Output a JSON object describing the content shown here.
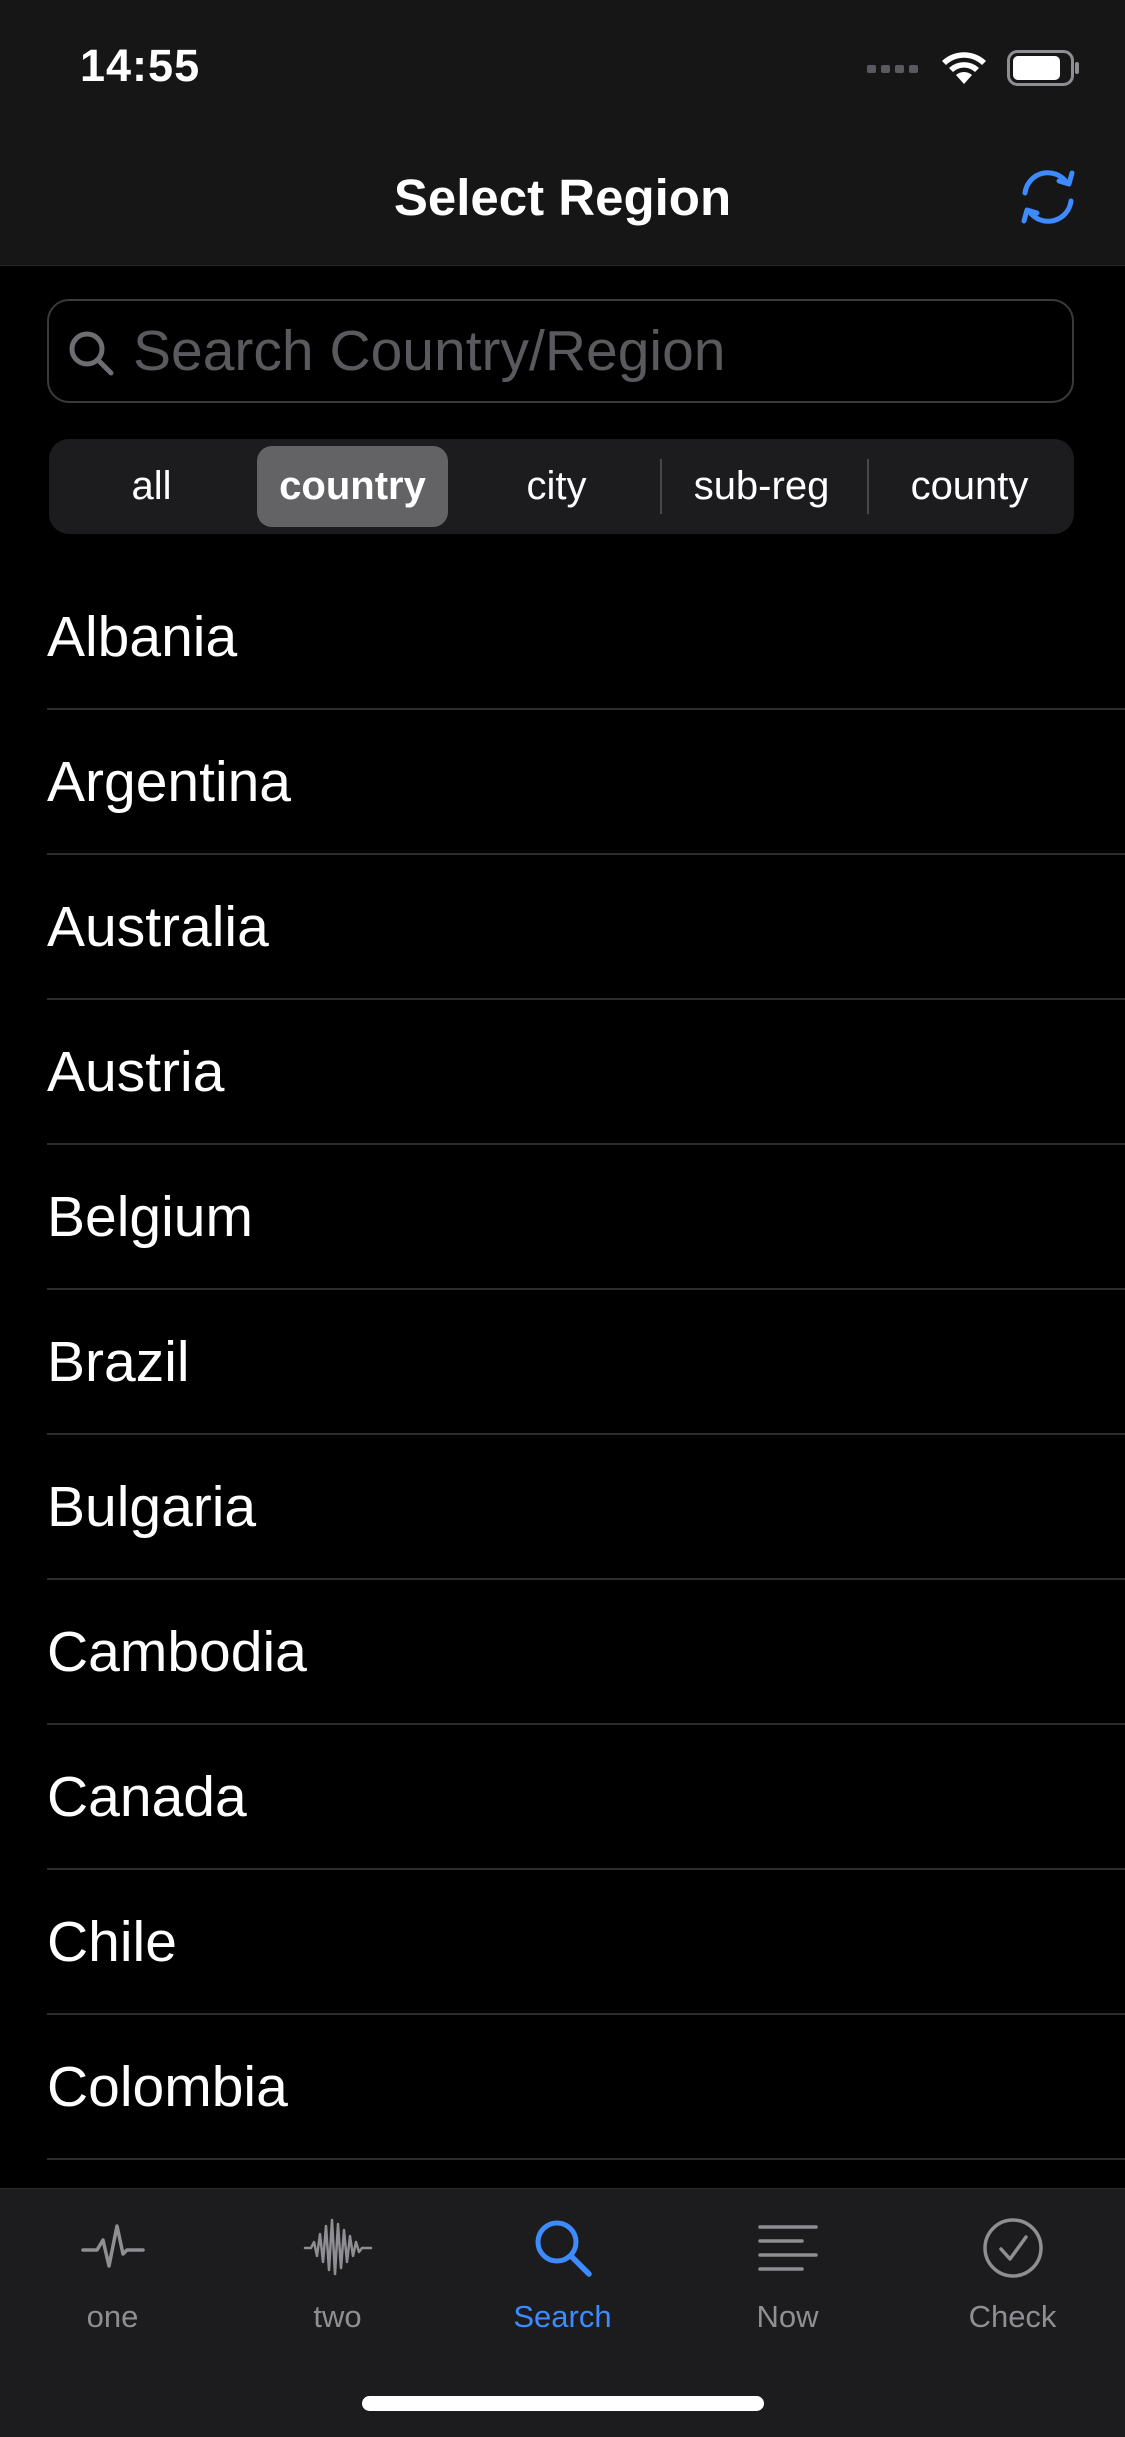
{
  "status_bar": {
    "time": "14:55"
  },
  "nav": {
    "title": "Select Region",
    "refresh_icon": "refresh-icon"
  },
  "search": {
    "placeholder": "Search Country/Region",
    "value": ""
  },
  "segments": [
    {
      "label": "all",
      "selected": false
    },
    {
      "label": "country",
      "selected": true
    },
    {
      "label": "city",
      "selected": false
    },
    {
      "label": "sub-reg",
      "selected": false
    },
    {
      "label": "county",
      "selected": false
    }
  ],
  "regions": [
    "Albania",
    "Argentina",
    "Australia",
    "Austria",
    "Belgium",
    "Brazil",
    "Bulgaria",
    "Cambodia",
    "Canada",
    "Chile",
    "Colombia"
  ],
  "tabs": [
    {
      "label": "one",
      "icon": "heartbeat-icon",
      "active": false
    },
    {
      "label": "two",
      "icon": "waveform-icon",
      "active": false
    },
    {
      "label": "Search",
      "icon": "search-icon",
      "active": true
    },
    {
      "label": "Now",
      "icon": "lines-icon",
      "active": false
    },
    {
      "label": "Check",
      "icon": "checkmark-circle-icon",
      "active": false
    }
  ],
  "colors": {
    "accent": "#3d8bff",
    "background": "#000000",
    "bar_background": "#161616",
    "inactive_tab": "#8e8e93"
  }
}
